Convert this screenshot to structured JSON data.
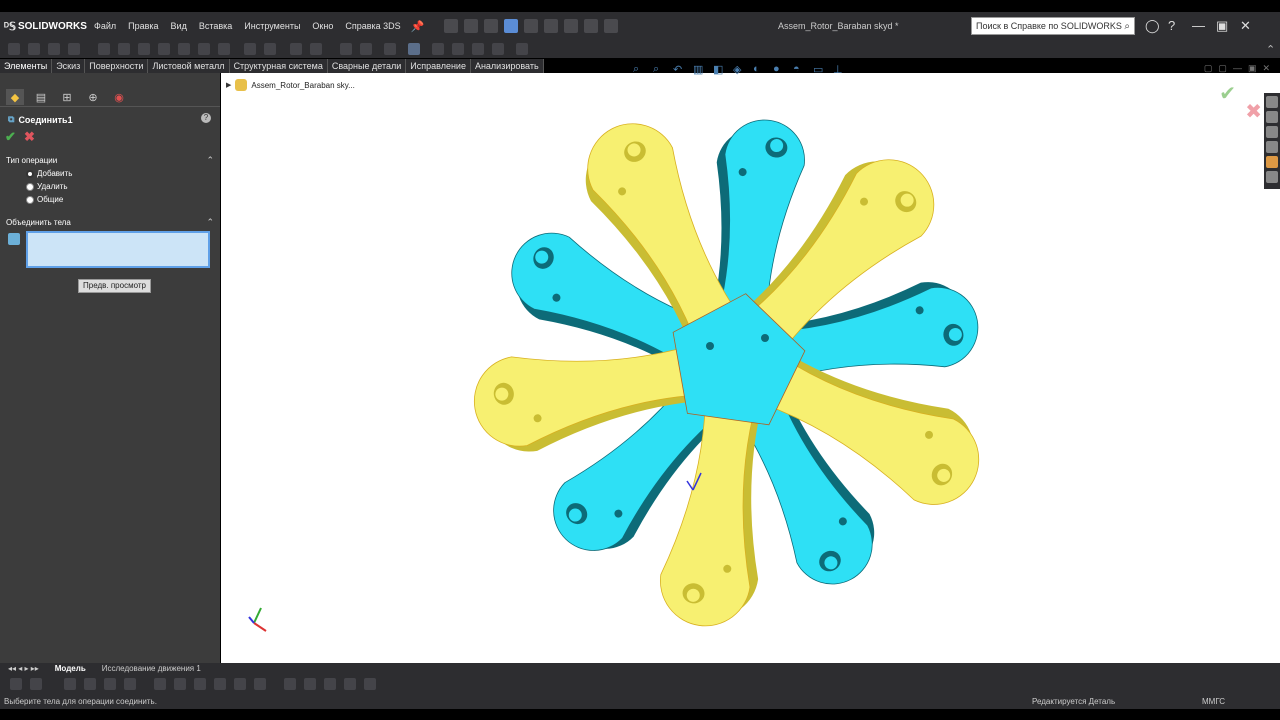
{
  "app": {
    "logo": "SOLIDWORKS",
    "menu": [
      "Файл",
      "Правка",
      "Вид",
      "Вставка",
      "Инструменты",
      "Окно",
      "Справка 3DS"
    ],
    "doc_title": "Assem_Rotor_Baraban skyd *",
    "search_placeholder": "Поиск в Справке по SOLIDWORKS"
  },
  "command_tabs": [
    "Элементы",
    "Эскиз",
    "Поверхности",
    "Листовой металл",
    "Структурная система",
    "Сварные детали",
    "Исправление",
    "Анализировать"
  ],
  "property_manager": {
    "feature_title": "Соединить1",
    "operation_section": "Тип операции",
    "operations": [
      "Добавить",
      "Удалить",
      "Общие"
    ],
    "bodies_section": "Объединить тела",
    "preview_button": "Предв. просмотр"
  },
  "viewport": {
    "tree_item": "Assem_Rotor_Baraban sky..."
  },
  "colors": {
    "cyan_body": "#2ee0f5",
    "cyan_side": "#0d6b78",
    "yellow_body": "#f7f071",
    "yellow_side": "#c9bd33",
    "accent": "#5fa0e8"
  },
  "bottom_tabs": [
    "Модель",
    "Исследование движения 1"
  ],
  "status": {
    "left": "Выберите тела для операции соединить.",
    "mid": "Редактируется Деталь",
    "right": "ММГС"
  }
}
